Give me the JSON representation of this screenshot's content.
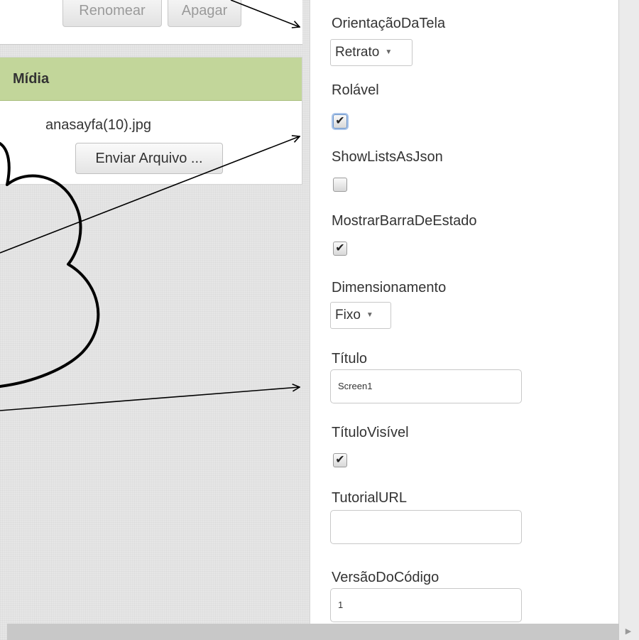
{
  "toolbar": {
    "rename_label": "Renomear",
    "delete_label": "Apagar"
  },
  "media": {
    "header": "Mídia",
    "file_name": "anasayfa(10).jpg",
    "upload_label": "Enviar Arquivo ..."
  },
  "properties": {
    "screen_orientation": {
      "label": "OrientaçãoDaTela",
      "value": "Retrato"
    },
    "scrollable": {
      "label": "Rolável",
      "checked": true
    },
    "show_lists_as_json": {
      "label": "ShowListsAsJson",
      "checked": false
    },
    "show_status_bar": {
      "label": "MostrarBarraDeEstado",
      "checked": true
    },
    "sizing": {
      "label": "Dimensionamento",
      "value": "Fixo"
    },
    "title": {
      "label": "Título",
      "value": "Screen1"
    },
    "title_visible": {
      "label": "TítuloVisível",
      "checked": true
    },
    "tutorial_url": {
      "label": "TutorialURL",
      "value": ""
    },
    "version_code": {
      "label": "VersãoDoCódigo",
      "value": "1"
    }
  },
  "glyphs": {
    "check": "✔",
    "caret": "▼",
    "scroll_right": "▶"
  },
  "colors": {
    "media_header": "#c2d69a",
    "annotation": "#000000"
  },
  "icons": [
    "check-icon",
    "caret-down-icon",
    "scroll-right-arrow-icon"
  ]
}
